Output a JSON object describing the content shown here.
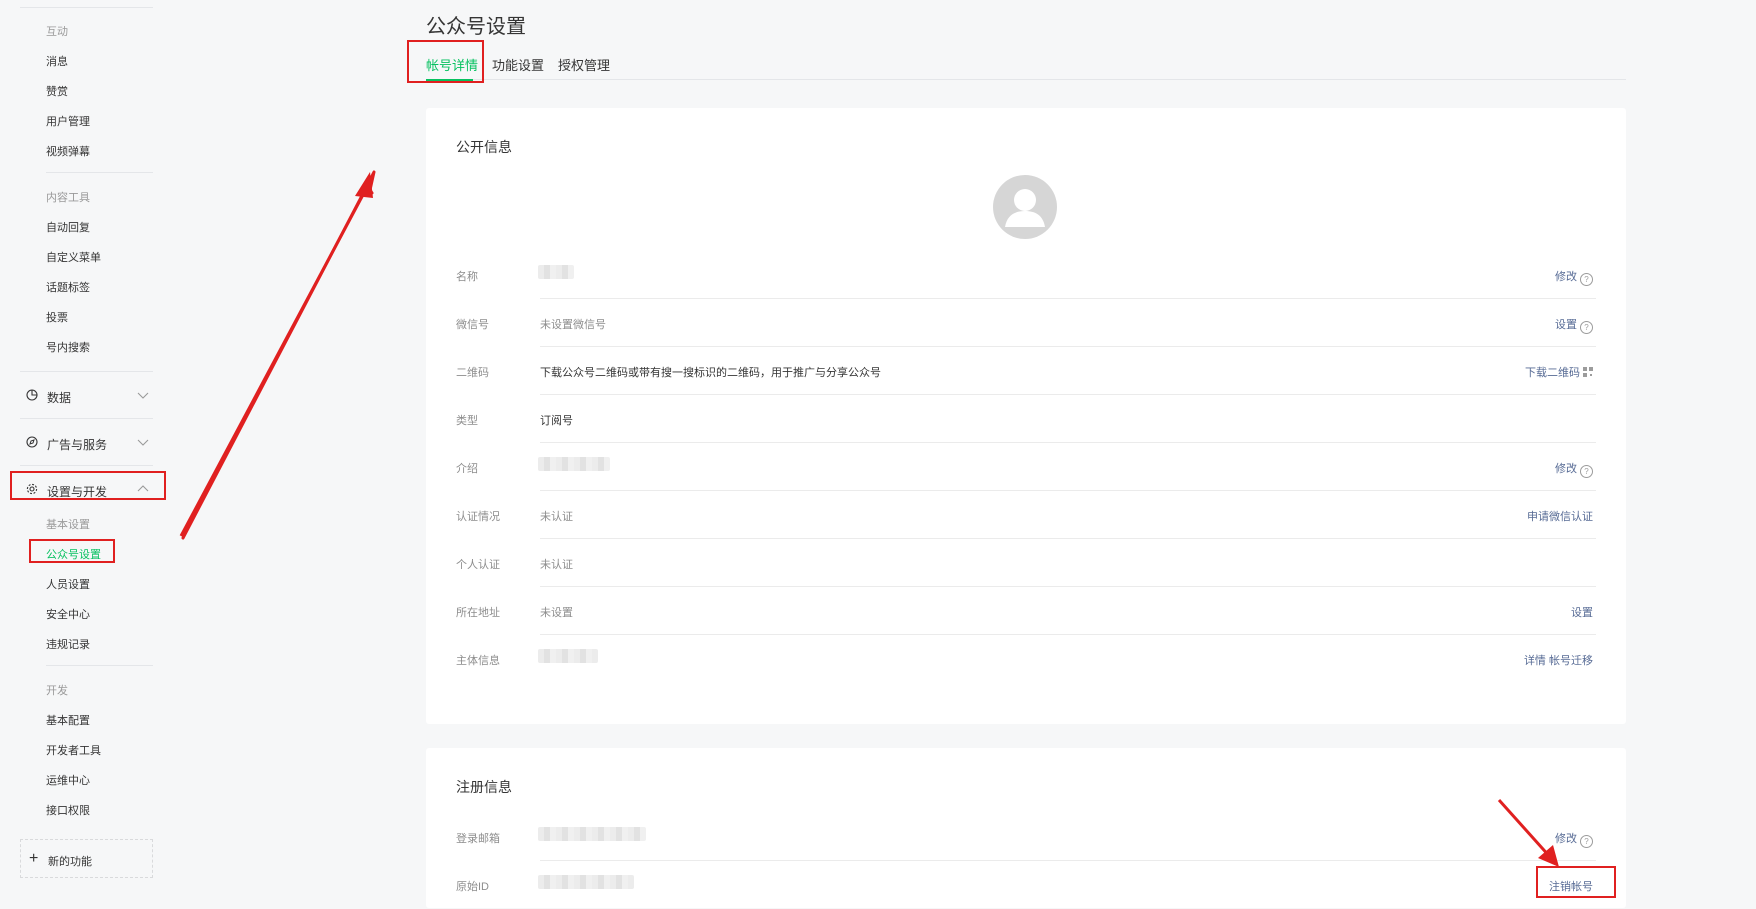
{
  "sidebar": {
    "interact": {
      "title": "互动",
      "items": [
        "消息",
        "赞赏",
        "用户管理",
        "视频弹幕"
      ]
    },
    "content_tools": {
      "title": "内容工具",
      "items": [
        "自动回复",
        "自定义菜单",
        "话题标签",
        "投票",
        "号内搜索"
      ]
    },
    "sections": {
      "data": "数据",
      "ads": "广告与服务",
      "settings": "设置与开发"
    },
    "basic_settings": {
      "title": "基本设置",
      "items": [
        "公众号设置",
        "人员设置",
        "安全中心",
        "违规记录"
      ],
      "active_index": 0
    },
    "dev": {
      "title": "开发",
      "items": [
        "基本配置",
        "开发者工具",
        "运维中心",
        "接口权限"
      ]
    },
    "new_feature": "新的功能"
  },
  "header": {
    "title": "公众号设置",
    "tabs": [
      "帐号详情",
      "功能设置",
      "授权管理"
    ],
    "active_tab": 0
  },
  "public_info": {
    "title": "公开信息",
    "rows": [
      {
        "label": "名称",
        "value": "",
        "action": "修改",
        "help": true
      },
      {
        "label": "微信号",
        "value": "未设置微信号",
        "action": "设置",
        "help": true
      },
      {
        "label": "二维码",
        "value": "下载公众号二维码或带有搜一搜标识的二维码，用于推广与分享公众号",
        "action": "下载二维码",
        "qr": true
      },
      {
        "label": "类型",
        "value": "订阅号",
        "action": ""
      },
      {
        "label": "介绍",
        "value": "",
        "action": "修改",
        "help": true
      },
      {
        "label": "认证情况",
        "value": "未认证",
        "action": "申请微信认证"
      },
      {
        "label": "个人认证",
        "value": "未认证",
        "action": ""
      },
      {
        "label": "所在地址",
        "value": "未设置",
        "action": "设置"
      },
      {
        "label": "主体信息",
        "value": "",
        "action": "详情 帐号迁移"
      }
    ]
  },
  "register_info": {
    "title": "注册信息",
    "rows": [
      {
        "label": "登录邮箱",
        "value": "",
        "action": "修改",
        "help": true
      },
      {
        "label": "原始ID",
        "value": "",
        "action": "注销帐号"
      }
    ]
  },
  "help_glyph": "?",
  "icons": {
    "data": "pie-chart-icon",
    "ads": "compass-icon",
    "settings": "gear-icon",
    "add": "plus-icon"
  },
  "colors": {
    "accent": "#07c160",
    "link": "#576b95",
    "annotation": "#e02020"
  }
}
